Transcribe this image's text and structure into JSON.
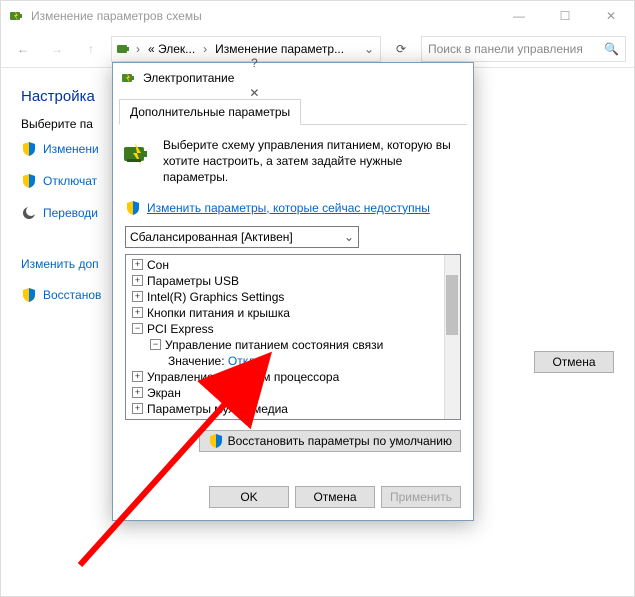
{
  "parent_window": {
    "title": "Изменение параметров схемы",
    "breadcrumb": {
      "seg1": "« Элек...",
      "seg2": "Изменение параметр..."
    },
    "search_placeholder": "Поиск в панели управления",
    "content": {
      "heading": "Настройка",
      "subheading": "Выберите па",
      "links": {
        "change": "Изменени",
        "disable": "Отключат",
        "translate": "Переводи",
        "change_extra": "Изменить доп",
        "restore": "Восстанов"
      }
    },
    "buttons": {
      "cancel": "Отмена"
    }
  },
  "dialog": {
    "title": "Электропитание",
    "tab": "Дополнительные параметры",
    "info_text": "Выберите схему управления питанием, которую вы хотите настроить, а затем задайте нужные параметры.",
    "link_unavailable": "Изменить параметры, которые сейчас недоступны",
    "combo_value": "Сбалансированная [Активен]",
    "tree": {
      "sleep": "Сон",
      "usb": "Параметры USB",
      "igfx": "Intel(R) Graphics Settings",
      "buttons_lid": "Кнопки питания и крышка",
      "pci": "PCI Express",
      "pci_link": "Управление питанием состояния связи",
      "value_label": "Значение:",
      "value": "Откл.",
      "cpu": "Управление питанием процессора",
      "display": "Экран",
      "multimedia": "Параметры мультимедиа"
    },
    "restore_button": "Восстановить параметры по умолчанию",
    "footer": {
      "ok": "OK",
      "cancel": "Отмена",
      "apply": "Применить"
    }
  }
}
